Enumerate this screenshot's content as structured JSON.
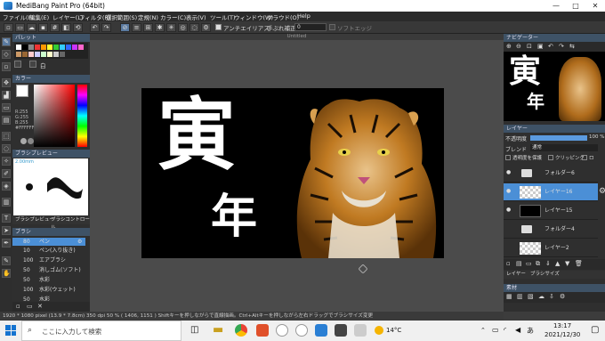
{
  "window": {
    "title": "MediBang Paint Pro (64bit)",
    "minimize": "—",
    "maximize": "□",
    "close": "✕"
  },
  "menu": [
    "ファイル(F)",
    "編集(E)",
    "レイヤー(L)",
    "フィルタ(R)",
    "選択範囲(S)",
    "定規(N)",
    "カラー(C)",
    "表示(V)",
    "ツール(T)",
    "ウィンドウ(W)",
    "クラウド(O)",
    "Help"
  ],
  "toolbar": {
    "antialias": "アンチエイリアス",
    "correction": "手ぶれ補正",
    "correction_value": "0",
    "soft_edge": "ソフトエッジ"
  },
  "canvas": {
    "tab_title": "Untitled",
    "kanji_top": "寅",
    "kanji_bottom": "年"
  },
  "left_panel": {
    "palette_header": "パレット",
    "palette_label": "白",
    "color_header": "カラー",
    "color_values": [
      "R:255",
      "G:255",
      "B:255",
      "#FFFFFF"
    ],
    "brush_preview_header": "ブラシプレビュー",
    "brush_size": "2.00mm",
    "brush_tabs": [
      "ブラシプレビュー",
      "ブラシコントロール"
    ],
    "brush_header": "ブラシ",
    "brushes": [
      {
        "size": "80",
        "name": "ペン",
        "selected": true
      },
      {
        "size": "10",
        "name": "ペン(入り抜き)",
        "selected": false
      },
      {
        "size": "100",
        "name": "エアブラシ",
        "selected": false
      },
      {
        "size": "50",
        "name": "消しゴム(ソフト)",
        "selected": false
      },
      {
        "size": "50",
        "name": "水彩",
        "selected": false
      },
      {
        "size": "100",
        "name": "水彩(ウェット)",
        "selected": false
      },
      {
        "size": "50",
        "name": "水彩",
        "selected": false
      }
    ]
  },
  "right_panel": {
    "navigator_header": "ナビゲーター",
    "layer_header": "レイヤー",
    "opacity_label": "不透明度",
    "opacity_value": "100 %",
    "opacity_fraction": 1.0,
    "blend_label": "ブレンド",
    "blend_value": "通常",
    "protect_label": "透明度を保護",
    "clipping_label": "クリッピング",
    "lock_label": "ロ",
    "layers": [
      {
        "name": "フォルダー6",
        "type": "folder",
        "selected": false
      },
      {
        "name": "レイヤー16",
        "type": "layer",
        "selected": true
      },
      {
        "name": "レイヤー15",
        "type": "black",
        "selected": false
      },
      {
        "name": "フォルダー4",
        "type": "folder",
        "selected": false
      },
      {
        "name": "レイヤー2",
        "type": "layer",
        "selected": false
      }
    ],
    "bottom_tabs": [
      "レイヤー",
      "ブラシサイズ"
    ],
    "materials_header": "素材"
  },
  "status": {
    "text": "1920 * 1080 pixel  (13.9 * 7.8cm)  350 dpi  50 %  ( 1406, 1151 )  Shiftキーを押しながらで直線描画。Ctrl+Altキーを押しながら左右ドラッグでブラシサイズ変更"
  },
  "taskbar": {
    "search_placeholder": "ここに入力して検索",
    "temperature": "14°C",
    "time": "13:17",
    "date": "2021/12/30",
    "ime": "あ"
  },
  "colors": {
    "selected_layer": "#4b8fd6",
    "accent": "#3e5266"
  }
}
